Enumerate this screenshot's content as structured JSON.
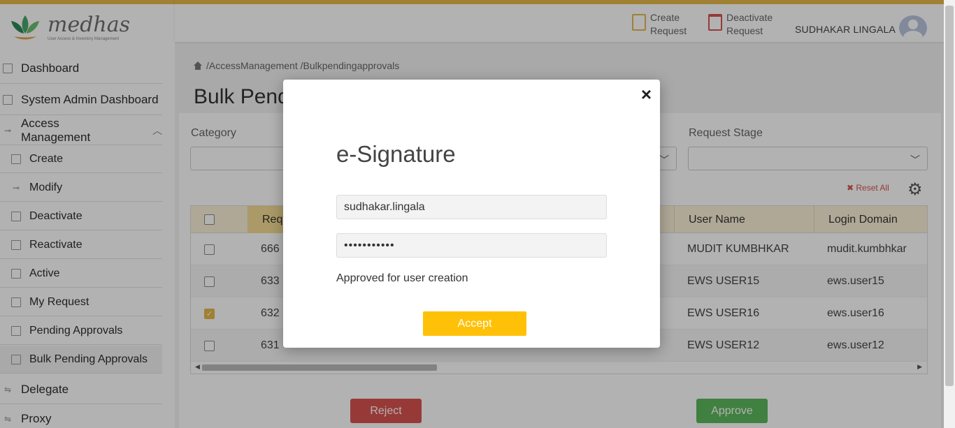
{
  "brand": {
    "name": "medhas",
    "tagline": "User Access & Inventory Management"
  },
  "sidebar": {
    "items": [
      {
        "label": "Dashboard"
      },
      {
        "label": "System Admin Dashboard"
      },
      {
        "label": "Access Management"
      },
      {
        "label": "Create"
      },
      {
        "label": "Modify"
      },
      {
        "label": "Deactivate"
      },
      {
        "label": "Reactivate"
      },
      {
        "label": "Active"
      },
      {
        "label": "My Request"
      },
      {
        "label": "Pending Approvals"
      },
      {
        "label": "Bulk Pending Approvals"
      },
      {
        "label": "Delegate"
      },
      {
        "label": "Proxy"
      }
    ]
  },
  "header": {
    "create_line1": "Create",
    "create_line2": "Request",
    "deactivate_line1": "Deactivate",
    "deactivate_line2": "Request",
    "user_name": "SUDHAKAR LINGALA"
  },
  "breadcrumb": "/AccessManagement /Bulkpendingapprovals",
  "page_title": "Bulk Pending Approvals",
  "filters": {
    "category_label": "Category",
    "request_stage_label": "Request Stage",
    "reset_label": "Reset All"
  },
  "table": {
    "headers": {
      "request": "Requ",
      "user_name": "User Name",
      "login_domain": "Login Domain"
    },
    "rows": [
      {
        "id": "666",
        "user_name": "MUDIT KUMBHKAR",
        "login_domain": "mudit.kumbhkar",
        "checked": false
      },
      {
        "id": "633",
        "user_name": "EWS USER15",
        "login_domain": "ews.user15",
        "checked": false
      },
      {
        "id": "632",
        "user_name": "EWS USER16",
        "login_domain": "ews.user16",
        "checked": true
      },
      {
        "id": "631",
        "user_name": "EWS USER12",
        "login_domain": "ews.user12",
        "checked": false
      }
    ]
  },
  "actions": {
    "reject": "Reject",
    "approve": "Approve"
  },
  "modal": {
    "title": "e-Signature",
    "username_value": "sudhakar.lingala",
    "password_value": "•••••••••••",
    "comment": "Approved for user creation",
    "accept": "Accept",
    "close": "×"
  },
  "colors": {
    "accent": "#e6b84a",
    "accept": "#ffc107",
    "reject": "#d9534f",
    "approve": "#5cb85c"
  }
}
